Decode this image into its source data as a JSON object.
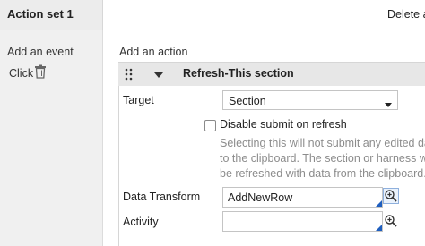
{
  "header": {
    "title": "Action set 1",
    "delete_label": "Delete a"
  },
  "events": {
    "add_label": "Add an event",
    "items": [
      {
        "label": "Click",
        "icon": "trash-icon"
      }
    ]
  },
  "actions": {
    "add_label": "Add an action",
    "current": {
      "title": "Refresh-This section",
      "drag_icon": "drag-handle-icon",
      "collapse_icon": "triangle-down-icon"
    }
  },
  "form": {
    "target_label": "Target",
    "target_value": "Section",
    "disable_submit_label": "Disable submit on refresh",
    "disable_submit_checked": false,
    "help_lines": [
      "Selecting this will not submit any edited da",
      "to the clipboard. The section or harness w",
      "be refreshed with data from the clipboard."
    ],
    "data_transform_label": "Data Transform",
    "data_transform_value": "AddNewRow",
    "activity_label": "Activity",
    "activity_value": ""
  },
  "colors": {
    "accent": "#1f5fbf",
    "panel_bg": "#f0f0f0",
    "header_bg": "#e7e7e7",
    "help_text": "#8c8c8c"
  }
}
